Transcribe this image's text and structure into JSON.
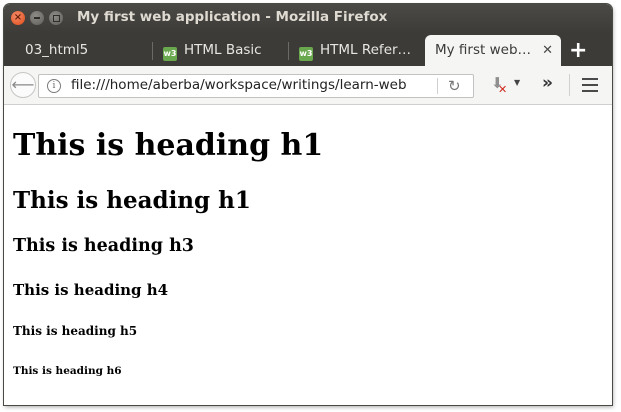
{
  "window": {
    "title": "My first web application - Mozilla Firefox"
  },
  "tabs": [
    {
      "label": "03_html5"
    },
    {
      "label": "HTML Basic",
      "icon": "w3-icon"
    },
    {
      "label": "HTML Refer…",
      "icon": "w3-icon"
    },
    {
      "label": "My first web…",
      "active": true
    }
  ],
  "nav": {
    "url": "file:///home/aberba/workspace/writings/learn-web"
  },
  "page": {
    "headings": [
      "This is heading h1",
      "This is heading h1",
      "This is heading h3",
      "This is heading h4",
      "This is heading h5",
      "This is heading h6"
    ]
  },
  "colors": {
    "titlebar": "#3c3b37",
    "close_button": "#df4a16",
    "tab_icon": "#6aa84f",
    "active_tab": "#f5f5f4"
  }
}
